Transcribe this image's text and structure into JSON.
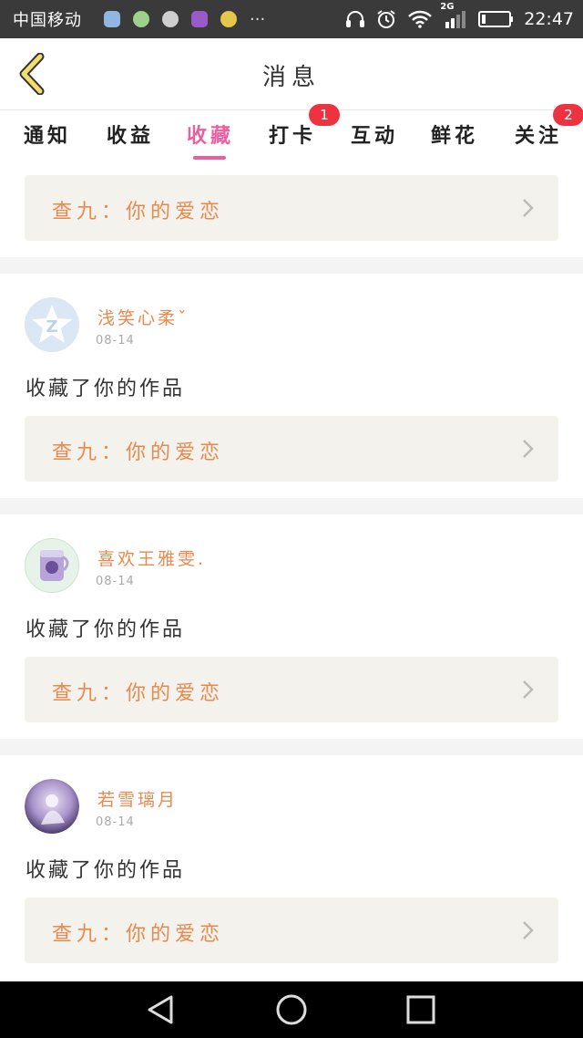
{
  "status_bar": {
    "carrier": "中国移动",
    "network": "2G",
    "time": "22:47",
    "overflow": "···",
    "icons": [
      "headphones-icon",
      "alarm-icon",
      "wifi-icon",
      "signal-icon",
      "battery-icon"
    ]
  },
  "header": {
    "title": "消息",
    "back_icon": "chevron-left-icon"
  },
  "tabs": [
    {
      "label": "通知",
      "active": false
    },
    {
      "label": "收益",
      "active": false
    },
    {
      "label": "收藏",
      "active": true
    },
    {
      "label": "打卡",
      "active": false,
      "badge": "1"
    },
    {
      "label": "互动",
      "active": false
    },
    {
      "label": "鲜花",
      "active": false
    },
    {
      "label": "关注",
      "active": false,
      "badge": "2"
    }
  ],
  "colors": {
    "accent": "#e8609e",
    "name_orange": "#e8894e",
    "badge_red": "#ee3340",
    "work_bg": "#f3f2ec"
  },
  "feed": {
    "partial_item": {
      "work_title": "查九：你的爱恋"
    },
    "items": [
      {
        "username": "浅笑心柔ˇ",
        "date": "08-14",
        "action": "收藏了你的作品",
        "work_title": "查九：你的爱恋",
        "avatar": "qzone-default-avatar"
      },
      {
        "username": "喜欢王雅雯.",
        "date": "08-14",
        "action": "收藏了你的作品",
        "work_title": "查九：你的爱恋",
        "avatar": "purple-cup-avatar"
      },
      {
        "username": "若雪璃月",
        "date": "08-14",
        "action": "收藏了你的作品",
        "work_title": "查九：你的爱恋",
        "avatar": "anime-girl-avatar"
      }
    ]
  },
  "nav_bar": [
    "back-triangle-icon",
    "home-circle-icon",
    "recents-square-icon"
  ]
}
